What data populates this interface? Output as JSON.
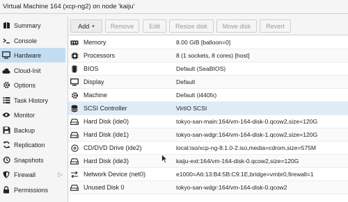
{
  "window": {
    "title": "Virtual Machine 164 (xcp-ng2) on node 'kaiju'"
  },
  "sidebar": {
    "items": [
      {
        "label": "Summary",
        "icon": "book-icon",
        "active": false
      },
      {
        "label": "Console",
        "icon": "terminal-icon",
        "active": false
      },
      {
        "label": "Hardware",
        "icon": "monitor-icon",
        "active": true
      },
      {
        "label": "Cloud-Init",
        "icon": "cloud-icon",
        "active": false
      },
      {
        "label": "Options",
        "icon": "gear-icon",
        "active": false
      },
      {
        "label": "Task History",
        "icon": "list-icon",
        "active": false
      },
      {
        "label": "Monitor",
        "icon": "eye-icon",
        "active": false
      },
      {
        "label": "Backup",
        "icon": "floppy-icon",
        "active": false
      },
      {
        "label": "Replication",
        "icon": "refresh-icon",
        "active": false
      },
      {
        "label": "Snapshots",
        "icon": "history-icon",
        "active": false
      },
      {
        "label": "Firewall",
        "icon": "shield-icon",
        "active": false,
        "expandable": true
      },
      {
        "label": "Permissions",
        "icon": "lock-icon",
        "active": false
      }
    ]
  },
  "toolbar": {
    "add": "Add",
    "remove": "Remove",
    "edit": "Edit",
    "resize": "Resize disk",
    "move": "Move disk",
    "revert": "Revert"
  },
  "hardware": {
    "rows": [
      {
        "label": "Memory",
        "value": "8.00 GiB [balloon=0]",
        "icon": "memory-icon"
      },
      {
        "label": "Processors",
        "value": "8 (1 sockets, 8 cores) [host]",
        "icon": "cpu-icon"
      },
      {
        "label": "BIOS",
        "value": "Default (SeaBIOS)",
        "icon": "chip-icon"
      },
      {
        "label": "Display",
        "value": "Default",
        "icon": "display-icon"
      },
      {
        "label": "Machine",
        "value": "Default (i440fx)",
        "icon": "machine-icon"
      },
      {
        "label": "SCSI Controller",
        "value": "VirtIO SCSI",
        "icon": "database-icon"
      },
      {
        "label": "Hard Disk (ide0)",
        "value": "tokyo-san-main:164/vm-164-disk-0.qcow2,size=120G",
        "icon": "harddisk-icon"
      },
      {
        "label": "Hard Disk (ide1)",
        "value": "tokyo-san-wdgr:164/vm-164-disk-1.qcow2,size=120G",
        "icon": "harddisk-icon"
      },
      {
        "label": "CD/DVD Drive (ide2)",
        "value": "local:iso/xcp-ng-8.1.0-2.iso,media=cdrom,size=575M",
        "icon": "cdrom-icon"
      },
      {
        "label": "Hard Disk (ide3)",
        "value": "kaiju-ext:164/vm-164-disk-0.qcow2,size=120G",
        "icon": "harddisk-icon"
      },
      {
        "label": "Network Device (net0)",
        "value": "e1000=A6:13:B4:5B:C9:1E,bridge=vmbr0,firewall=1",
        "icon": "network-icon"
      },
      {
        "label": "Unused Disk 0",
        "value": "tokyo-san-wdgr:164/vm-164-disk-0.qcow2",
        "icon": "harddisk-icon"
      }
    ]
  }
}
